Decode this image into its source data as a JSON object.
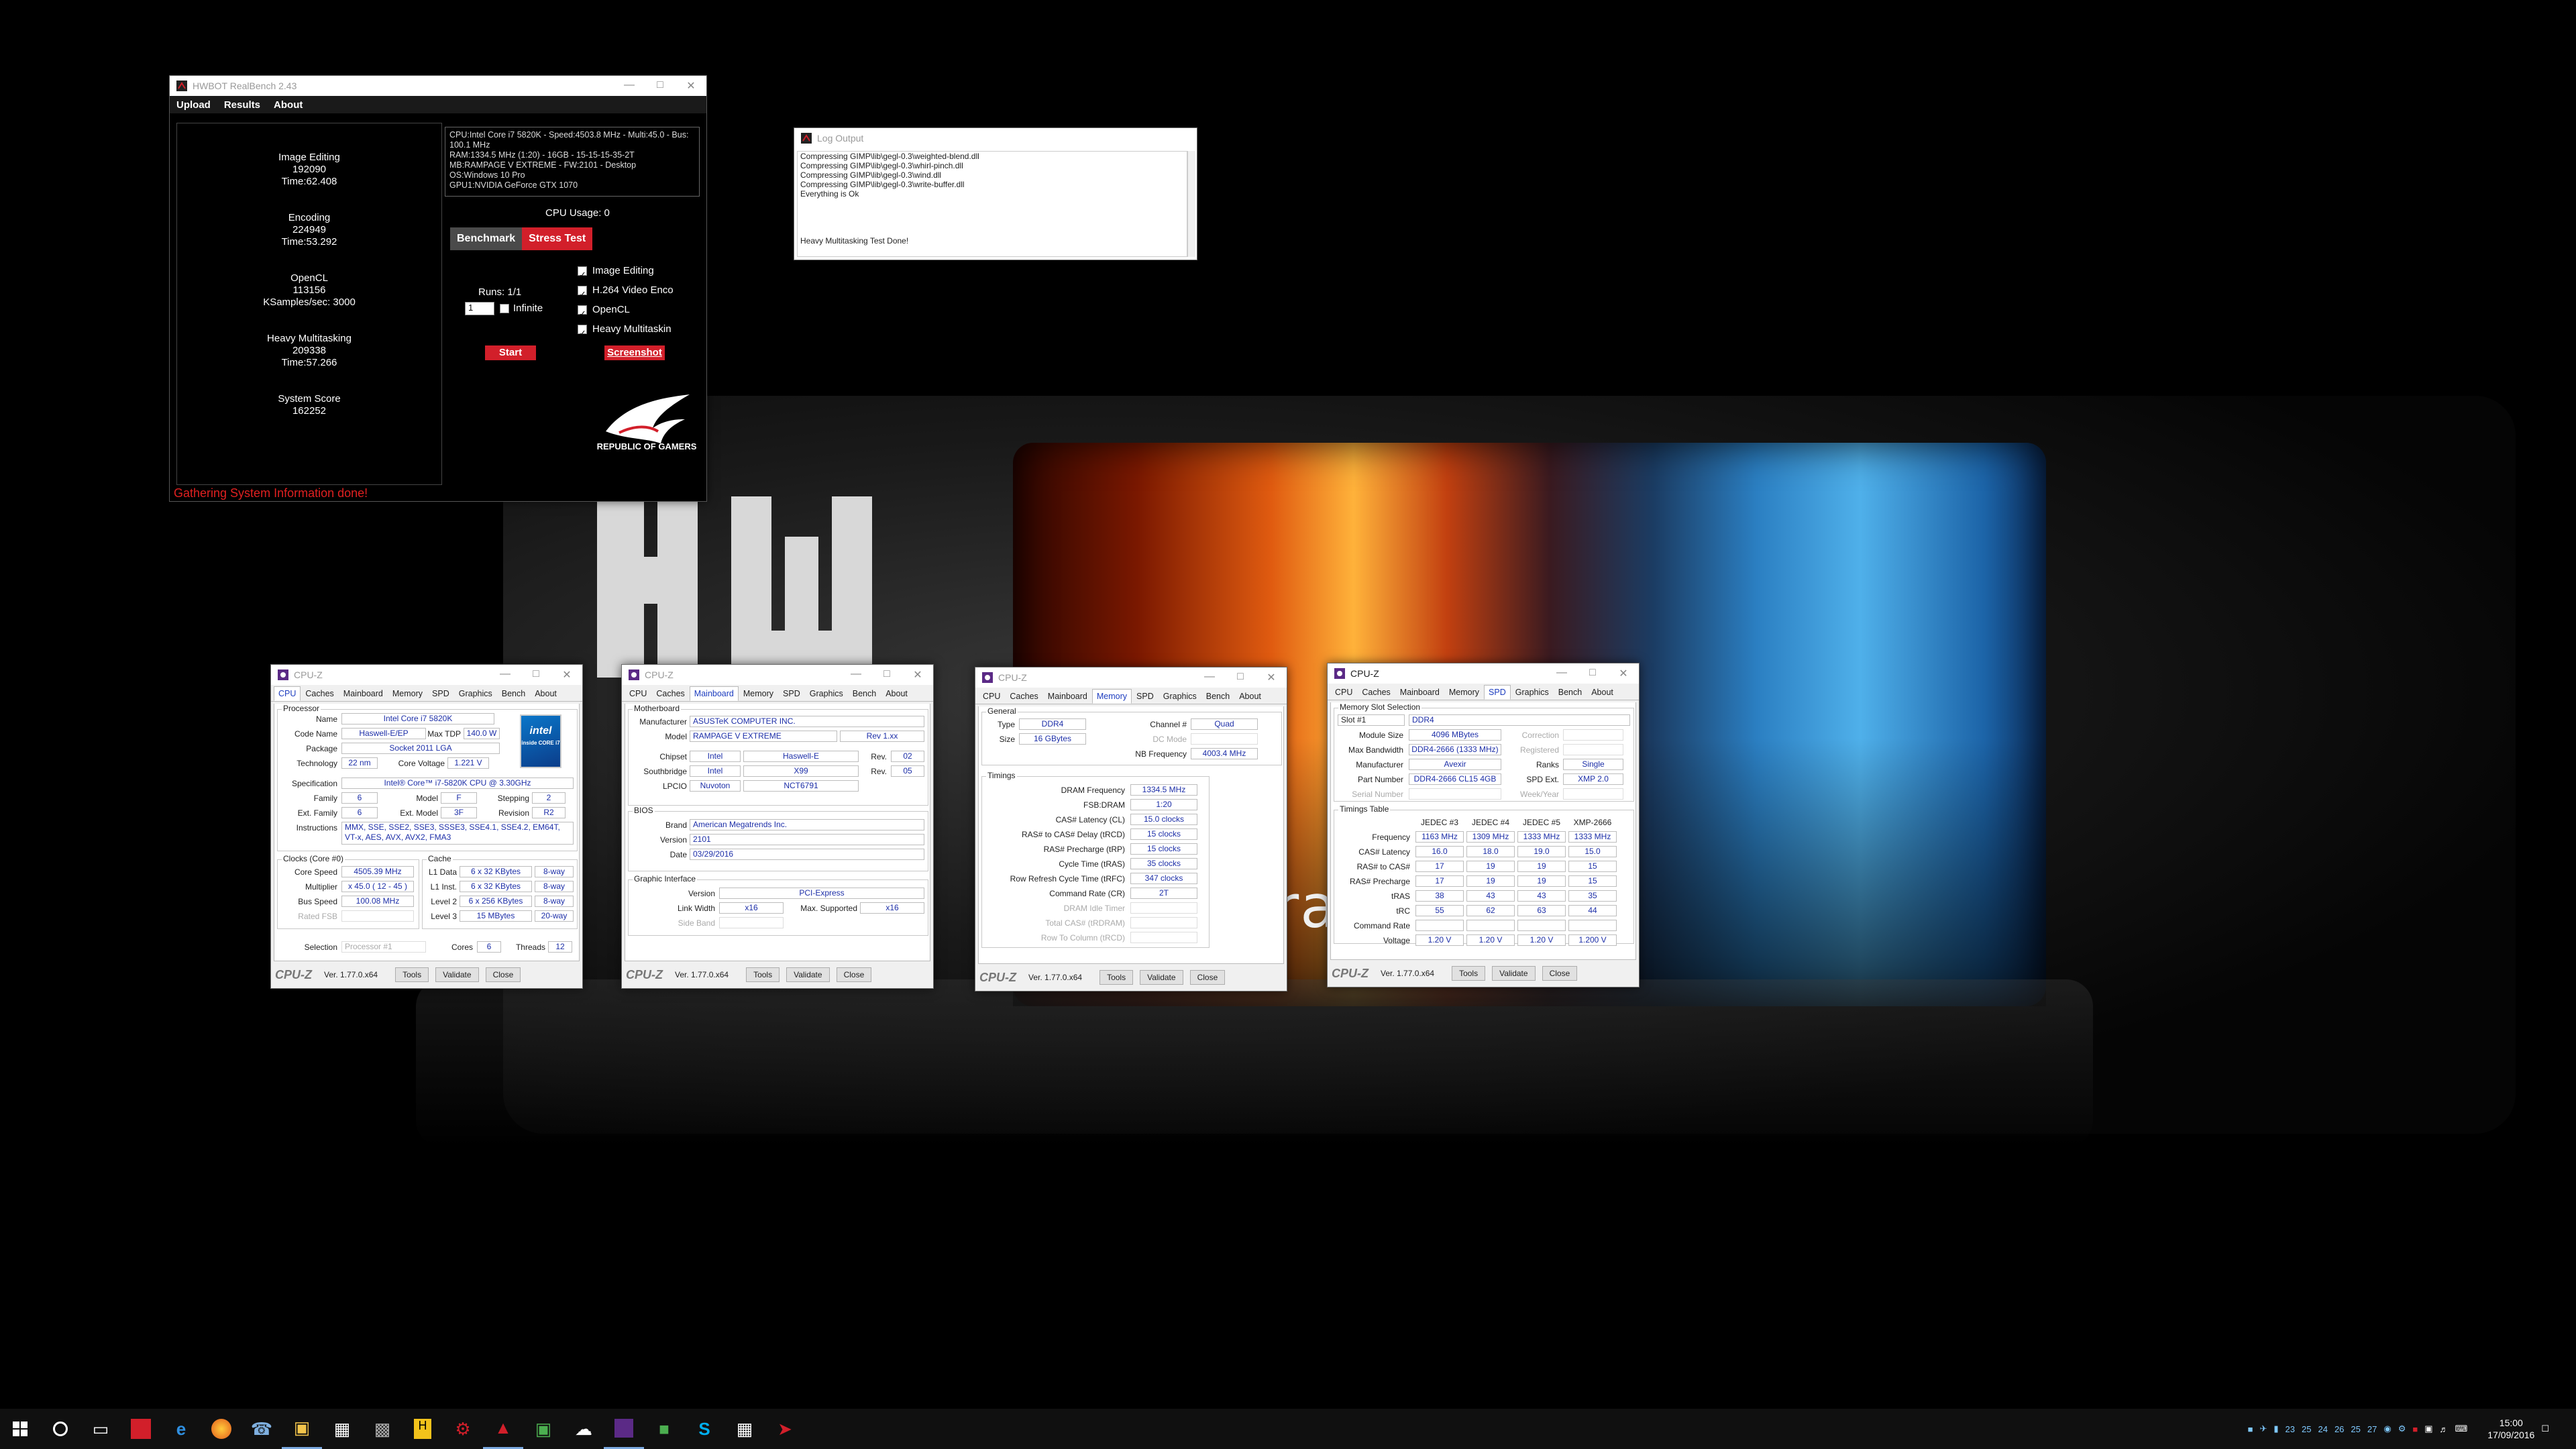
{
  "wallpaper": {
    "text": "ration"
  },
  "realbench": {
    "title": "HWBOT RealBench 2.43",
    "menu": [
      "Upload",
      "Results",
      "About"
    ],
    "results": [
      {
        "name": "Image Editing",
        "score": "192090",
        "time": "Time:62.408"
      },
      {
        "name": "Encoding",
        "score": "224949",
        "time": "Time:53.292"
      },
      {
        "name": "OpenCL",
        "score": "113156",
        "time": "KSamples/sec: 3000"
      },
      {
        "name": "Heavy Multitasking",
        "score": "209338",
        "time": "Time:57.266"
      },
      {
        "name": "System Score",
        "score": "162252",
        "time": ""
      }
    ],
    "sysinfo": [
      "CPU:Intel Core i7 5820K - Speed:4503.8  MHz - Multi:45.0 - Bus: 100.1 MHz",
      "RAM:1334.5 MHz (1:20) - 16GB - 15-15-15-35-2T",
      "MB:RAMPAGE V EXTREME - FW:2101 - Desktop",
      "OS:Windows 10 Pro",
      "GPU1:NVIDIA GeForce GTX 1070"
    ],
    "cpu_usage": "CPU Usage: 0",
    "tab_benchmark": "Benchmark",
    "tab_stress": "Stress Test",
    "runs": "Runs: 1/1",
    "runs_value": "1",
    "infinite": "Infinite",
    "options": [
      "Image Editing",
      "H.264 Video Enco",
      "OpenCL",
      "Heavy Multitaskin"
    ],
    "start": "Start",
    "screenshot": "Screenshot",
    "rog_text": "REPUBLIC OF GAMERS",
    "status": "Gathering System Information done!"
  },
  "log": {
    "title": "Log Output",
    "lines": [
      "Compressing  GIMP\\lib\\gegl-0.3\\weighted-blend.dll",
      "Compressing  GIMP\\lib\\gegl-0.3\\whirl-pinch.dll",
      "Compressing  GIMP\\lib\\gegl-0.3\\wind.dll",
      "Compressing  GIMP\\lib\\gegl-0.3\\write-buffer.dll",
      "",
      "Everything is Ok",
      "",
      "",
      "",
      "",
      "Heavy Multitasking Test Done!"
    ]
  },
  "cpuz_common": {
    "title": "CPU-Z",
    "brand": "CPU-Z",
    "version": "Ver. 1.77.0.x64",
    "tools": "Tools",
    "validate": "Validate",
    "close": "Close",
    "tabs": [
      "CPU",
      "Caches",
      "Mainboard",
      "Memory",
      "SPD",
      "Graphics",
      "Bench",
      "About"
    ]
  },
  "cpuz1": {
    "processor": "Processor",
    "name_l": "Name",
    "name": "Intel Core i7 5820K",
    "code_l": "Code Name",
    "code": "Haswell-E/EP",
    "tdp_l": "Max TDP",
    "tdp": "140.0 W",
    "pkg_l": "Package",
    "pkg": "Socket 2011 LGA",
    "tech_l": "Technology",
    "tech": "22 nm",
    "cv_l": "Core Voltage",
    "cv": "1.221 V",
    "spec_l": "Specification",
    "spec": "Intel® Core™ i7-5820K CPU @ 3.30GHz",
    "fam_l": "Family",
    "fam": "6",
    "model_l": "Model",
    "model": "F",
    "step_l": "Stepping",
    "step": "2",
    "efam_l": "Ext. Family",
    "efam": "6",
    "emodel_l": "Ext. Model",
    "emodel": "3F",
    "rev_l": "Revision",
    "rev": "R2",
    "instr_l": "Instructions",
    "instr": "MMX, SSE, SSE2, SSE3, SSSE3, SSE4.1, SSE4.2, EM64T, VT-x, AES, AVX, AVX2, FMA3",
    "clocks": "Clocks (Core #0)",
    "cache": "Cache",
    "cs_l": "Core Speed",
    "cs": "4505.39 MHz",
    "mul_l": "Multiplier",
    "mul": "x 45.0 ( 12 - 45 )",
    "bus_l": "Bus Speed",
    "bus": "100.08 MHz",
    "fsb_l": "Rated FSB",
    "l1d_l": "L1 Data",
    "l1d": "6 x 32 KBytes",
    "l1d_w": "8-way",
    "l1i_l": "L1 Inst.",
    "l1i": "6 x 32 KBytes",
    "l1i_w": "8-way",
    "l2_l": "Level 2",
    "l2": "6 x 256 KBytes",
    "l2_w": "8-way",
    "l3_l": "Level 3",
    "l3": "15 MBytes",
    "l3_w": "20-way",
    "sel_l": "Selection",
    "sel": "Processor #1",
    "cores_l": "Cores",
    "cores": "6",
    "thr_l": "Threads",
    "thr": "12",
    "intel_brand": "intel",
    "intel_sub": "inside CORE i7"
  },
  "cpuz2": {
    "mobo": "Motherboard",
    "man_l": "Manufacturer",
    "man": "ASUSTeK COMPUTER INC.",
    "model_l": "Model",
    "model": "RAMPAGE V EXTREME",
    "model_rev": "Rev 1.xx",
    "chip_l": "Chipset",
    "chip_a": "Intel",
    "chip_b": "Haswell-E",
    "chip_rl": "Rev.",
    "chip_r": "02",
    "sb_l": "Southbridge",
    "sb_a": "Intel",
    "sb_b": "X99",
    "sb_rl": "Rev.",
    "sb_r": "05",
    "lpc_l": "LPCIO",
    "lpc_a": "Nuvoton",
    "lpc_b": "NCT6791",
    "bios": "BIOS",
    "brand_l": "Brand",
    "brand": "American Megatrends Inc.",
    "ver_l": "Version",
    "ver": "2101",
    "date_l": "Date",
    "date": "03/29/2016",
    "gi": "Graphic Interface",
    "giv_l": "Version",
    "giv": "PCI-Express",
    "lw_l": "Link Width",
    "lw": "x16",
    "ms_l": "Max. Supported",
    "ms": "x16",
    "sbd_l": "Side Band"
  },
  "cpuz3": {
    "general": "General",
    "type_l": "Type",
    "type": "DDR4",
    "ch_l": "Channel #",
    "ch": "Quad",
    "dc_l": "DC Mode",
    "size_l": "Size",
    "size": "16 GBytes",
    "nb_l": "NB Frequency",
    "nb": "4003.4 MHz",
    "timings": "Timings",
    "rows": [
      {
        "l": "DRAM Frequency",
        "v": "1334.5 MHz"
      },
      {
        "l": "FSB:DRAM",
        "v": "1:20"
      },
      {
        "l": "CAS# Latency (CL)",
        "v": "15.0 clocks"
      },
      {
        "l": "RAS# to CAS# Delay (tRCD)",
        "v": "15 clocks"
      },
      {
        "l": "RAS# Precharge (tRP)",
        "v": "15 clocks"
      },
      {
        "l": "Cycle Time (tRAS)",
        "v": "35 clocks"
      },
      {
        "l": "Row Refresh Cycle Time (tRFC)",
        "v": "347 clocks"
      },
      {
        "l": "Command Rate (CR)",
        "v": "2T"
      },
      {
        "l": "DRAM Idle Timer",
        "v": ""
      },
      {
        "l": "Total CAS# (tRDRAM)",
        "v": ""
      },
      {
        "l": "Row To Column (tRCD)",
        "v": ""
      }
    ]
  },
  "cpuz4": {
    "slotsel": "Memory Slot Selection",
    "slot": "Slot #1",
    "slottype": "DDR4",
    "msize_l": "Module Size",
    "msize": "4096 MBytes",
    "corr_l": "Correction",
    "bw_l": "Max Bandwidth",
    "bw": "DDR4-2666 (1333 MHz)",
    "reg_l": "Registered",
    "man_l": "Manufacturer",
    "man": "Avexir",
    "ranks_l": "Ranks",
    "ranks": "Single",
    "pn_l": "Part Number",
    "pn": "DDR4-2666 CL15 4GB",
    "spd_l": "SPD Ext.",
    "spd": "XMP 2.0",
    "sn_l": "Serial Number",
    "wy_l": "Week/Year",
    "tt": "Timings Table",
    "cols": [
      "JEDEC #3",
      "JEDEC #4",
      "JEDEC #5",
      "XMP-2666"
    ],
    "trows": [
      {
        "l": "Frequency",
        "v": [
          "1163 MHz",
          "1309 MHz",
          "1333 MHz",
          "1333 MHz"
        ]
      },
      {
        "l": "CAS# Latency",
        "v": [
          "16.0",
          "18.0",
          "19.0",
          "15.0"
        ]
      },
      {
        "l": "RAS# to CAS#",
        "v": [
          "17",
          "19",
          "19",
          "15"
        ]
      },
      {
        "l": "RAS# Precharge",
        "v": [
          "17",
          "19",
          "19",
          "15"
        ]
      },
      {
        "l": "tRAS",
        "v": [
          "38",
          "43",
          "43",
          "35"
        ]
      },
      {
        "l": "tRC",
        "v": [
          "55",
          "62",
          "63",
          "44"
        ]
      },
      {
        "l": "Command Rate",
        "v": [
          "",
          "",
          "",
          ""
        ]
      },
      {
        "l": "Voltage",
        "v": [
          "1.20 V",
          "1.20 V",
          "1.20 V",
          "1.200 V"
        ]
      }
    ]
  },
  "taskbar": {
    "clock_time": "15:00",
    "clock_date": "17/09/2016",
    "tray": [
      "23",
      "25",
      "24",
      "26",
      "25",
      "27"
    ]
  }
}
